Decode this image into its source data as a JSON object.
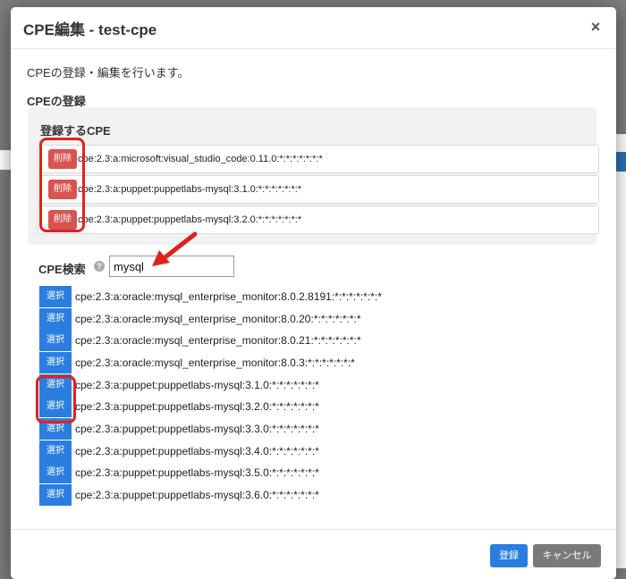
{
  "modal": {
    "title": "CPE編集 - test-cpe",
    "close_glyph": "×",
    "description": "CPEの登録・編集を行います。",
    "section_label": "CPEの登録"
  },
  "registered": {
    "title": "登録するCPE",
    "delete_label": "削除",
    "items": [
      "cpe:2.3:a:microsoft:visual_studio_code:0.11.0:*:*:*:*:*:*:*",
      "cpe:2.3:a:puppet:puppetlabs-mysql:3.1.0:*:*:*:*:*:*:*",
      "cpe:2.3:a:puppet:puppetlabs-mysql:3.2.0:*:*:*:*:*:*:*"
    ]
  },
  "search": {
    "label": "CPE検索",
    "help_glyph": "?",
    "value": "mysql",
    "select_label": "選択",
    "results": [
      "cpe:2.3:a:oracle:mysql_enterprise_monitor:8.0.2.8191:*:*:*:*:*:*:*",
      "cpe:2.3:a:oracle:mysql_enterprise_monitor:8.0.20:*:*:*:*:*:*:*",
      "cpe:2.3:a:oracle:mysql_enterprise_monitor:8.0.21:*:*:*:*:*:*:*",
      "cpe:2.3:a:oracle:mysql_enterprise_monitor:8.0.3:*:*:*:*:*:*:*",
      "cpe:2.3:a:puppet:puppetlabs-mysql:3.1.0:*:*:*:*:*:*:*",
      "cpe:2.3:a:puppet:puppetlabs-mysql:3.2.0:*:*:*:*:*:*:*",
      "cpe:2.3:a:puppet:puppetlabs-mysql:3.3.0:*:*:*:*:*:*:*",
      "cpe:2.3:a:puppet:puppetlabs-mysql:3.4.0:*:*:*:*:*:*:*",
      "cpe:2.3:a:puppet:puppetlabs-mysql:3.5.0:*:*:*:*:*:*:*",
      "cpe:2.3:a:puppet:puppetlabs-mysql:3.6.0:*:*:*:*:*:*:*"
    ]
  },
  "footer": {
    "register_label": "登録",
    "cancel_label": "キャンセル"
  },
  "colors": {
    "primary": "#2b7ee0",
    "danger": "#d9534f",
    "annotation": "#e0221f"
  }
}
